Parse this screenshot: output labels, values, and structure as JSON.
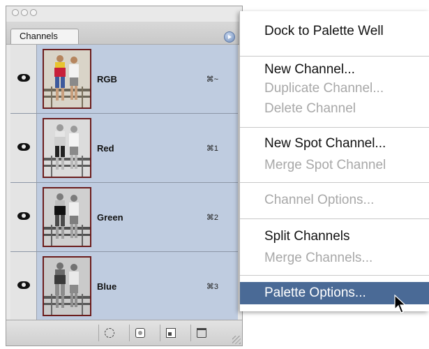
{
  "palette": {
    "tab_label": "Channels",
    "channels": [
      {
        "name": "RGB",
        "shortcut": "⌘~"
      },
      {
        "name": "Red",
        "shortcut": "⌘1"
      },
      {
        "name": "Green",
        "shortcut": "⌘2"
      },
      {
        "name": "Blue",
        "shortcut": "⌘3"
      }
    ],
    "footer_buttons": [
      "load-selection-icon",
      "save-selection-icon",
      "new-channel-icon",
      "trash-icon"
    ]
  },
  "menu": {
    "items": [
      {
        "label": "Dock to Palette Well",
        "enabled": true
      },
      {
        "label": "New Channel...",
        "enabled": true
      },
      {
        "label": "Duplicate Channel...",
        "enabled": false
      },
      {
        "label": "Delete Channel",
        "enabled": false
      },
      {
        "label": "New Spot Channel...",
        "enabled": true
      },
      {
        "label": "Merge Spot Channel",
        "enabled": false
      },
      {
        "label": "Channel Options...",
        "enabled": false
      },
      {
        "label": "Split Channels",
        "enabled": true
      },
      {
        "label": "Merge Channels...",
        "enabled": false
      },
      {
        "label": "Palette Options...",
        "enabled": true,
        "selected": true
      }
    ]
  },
  "colors": {
    "selection": "#4a6a96",
    "channel_row": "#bfcce0"
  }
}
